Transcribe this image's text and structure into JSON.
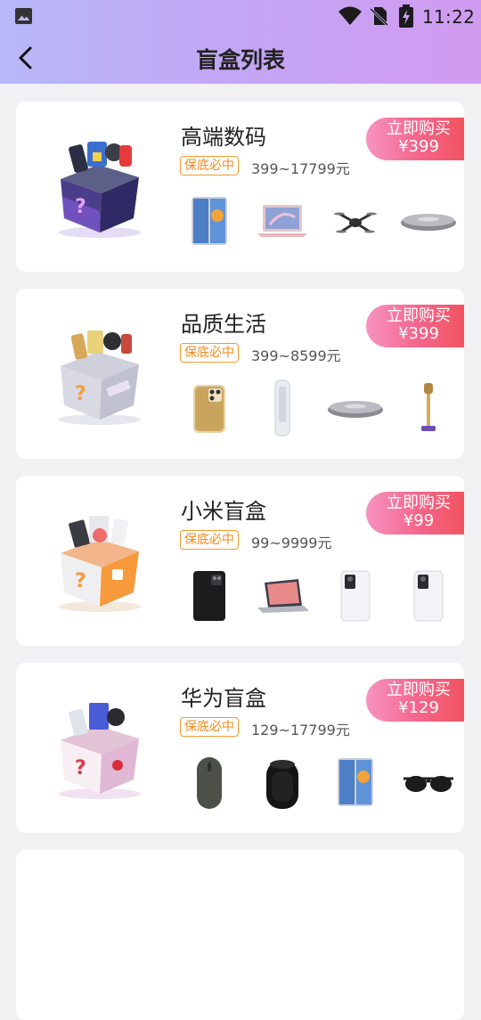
{
  "status_bar": {
    "time": "11:22"
  },
  "header": {
    "title": "盲盒列表"
  },
  "boxes": [
    {
      "title": "高端数码",
      "guarantee": "保底必中",
      "price_range": "399~17799元",
      "buy_label": "立即购买",
      "price": "¥399",
      "products": [
        "phone-fold-icon",
        "laptop-icon",
        "drone-icon",
        "speaker-icon"
      ]
    },
    {
      "title": "品质生活",
      "guarantee": "保底必中",
      "price_range": "399~8599元",
      "buy_label": "立即购买",
      "price": "¥399",
      "products": [
        "phone-gold-icon",
        "tower-fan-icon",
        "speaker-icon",
        "vacuum-icon"
      ]
    },
    {
      "title": "小米盲盒",
      "guarantee": "保底必中",
      "price_range": "99~9999元",
      "buy_label": "立即购买",
      "price": "¥99",
      "products": [
        "phone-dark-icon",
        "laptop-dark-icon",
        "phone-white-icon",
        "phone-white-icon"
      ]
    },
    {
      "title": "华为盲盒",
      "guarantee": "保底必中",
      "price_range": "129~17799元",
      "buy_label": "立即购买",
      "price": "¥129",
      "products": [
        "mouse-icon",
        "speaker-black-icon",
        "phone-fold-icon",
        "sunglasses-icon"
      ]
    }
  ],
  "colors": {
    "header_gradient_start": "#b8b8f8",
    "header_gradient_end": "#d19bf0",
    "buy_gradient_start": "#f793c1",
    "buy_gradient_end": "#f05158",
    "guarantee": "#f2881c",
    "background": "#f1f1f3"
  }
}
